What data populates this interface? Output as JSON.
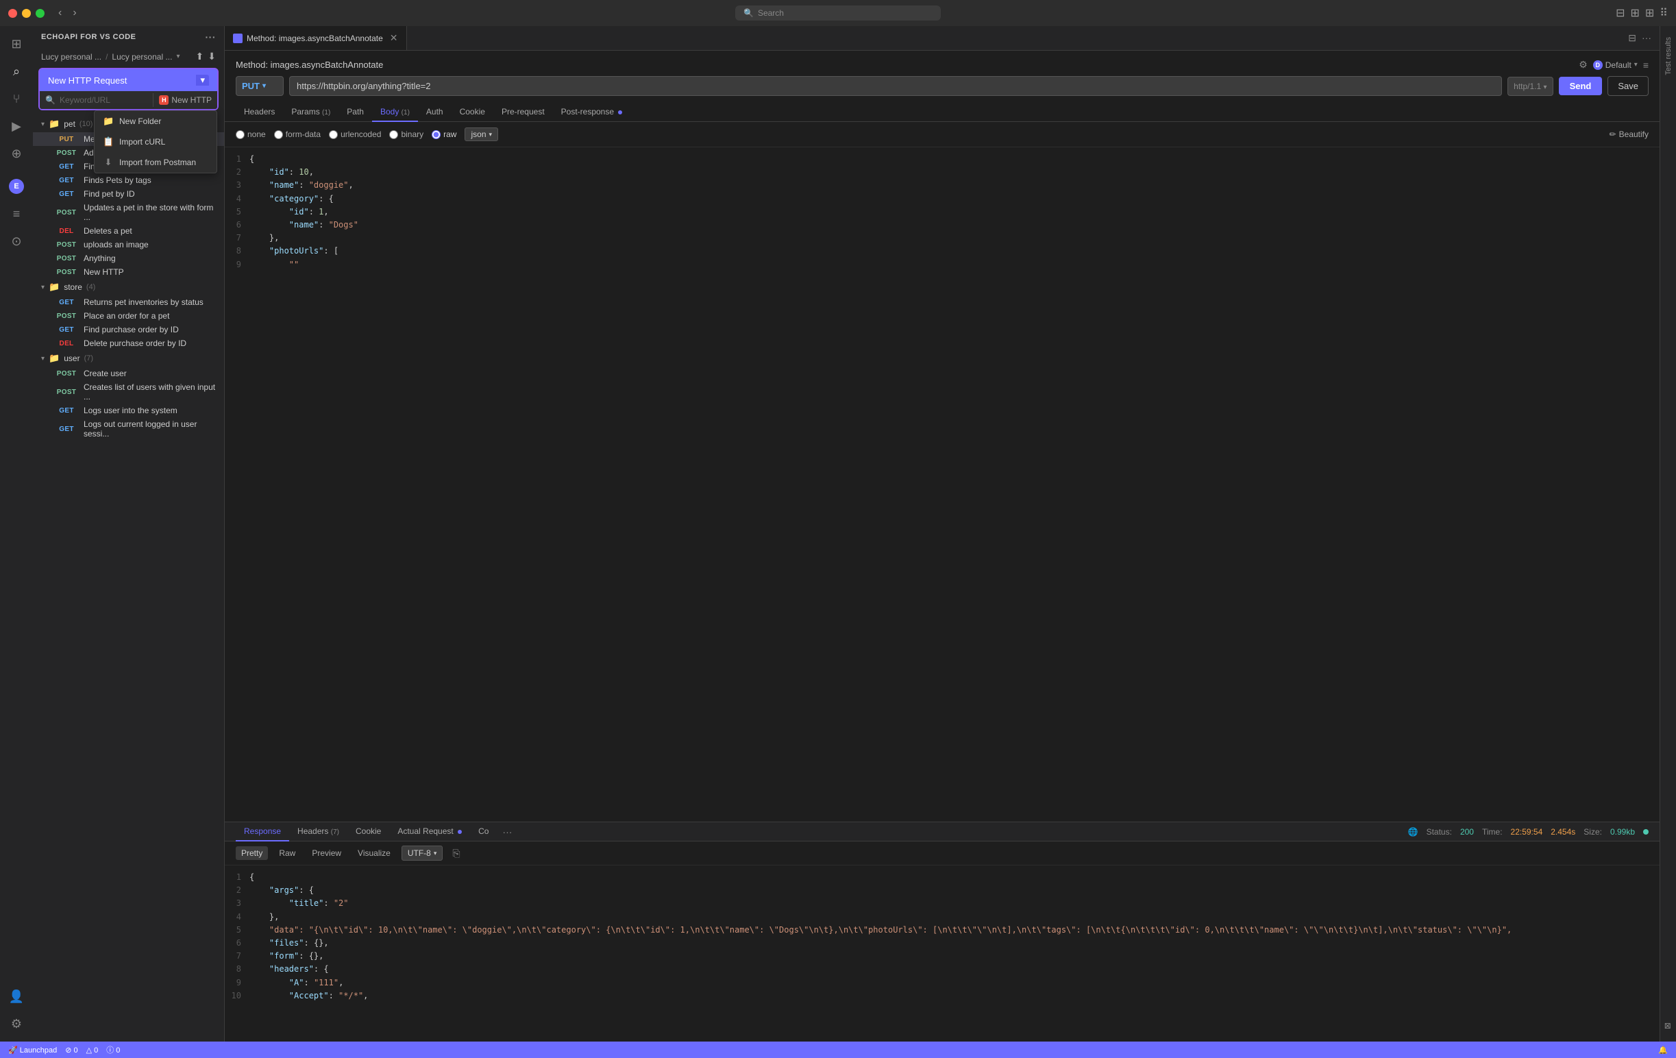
{
  "titlebar": {
    "search_placeholder": "Search"
  },
  "sidebar": {
    "title": "ECHOAPI FOR VS CODE",
    "workspace": "Lucy personal ...",
    "workspace_full": "Lucy personal ...",
    "new_request_label": "New HTTP Request",
    "search_placeholder": "Keyword/URL",
    "new_http_label": "New HTTP",
    "dropdown": {
      "items": [
        {
          "icon": "📁",
          "label": "New Folder"
        },
        {
          "icon": "📋",
          "label": "Import cURL"
        },
        {
          "icon": "⬇",
          "label": "Import from Postman"
        }
      ]
    },
    "groups": [
      {
        "name": "pet",
        "count": 10,
        "items": [
          {
            "method": "PUT",
            "label": "Method: images..."
          },
          {
            "method": "POST",
            "label": "Add a new pet t..."
          },
          {
            "method": "GET",
            "label": "Finds Pets by st..."
          },
          {
            "method": "GET",
            "label": "Finds Pets by tags"
          },
          {
            "method": "GET",
            "label": "Find pet by ID"
          },
          {
            "method": "POST",
            "label": "Updates a pet in the store with form ..."
          },
          {
            "method": "DEL",
            "label": "Deletes a pet"
          },
          {
            "method": "POST",
            "label": "uploads an image"
          },
          {
            "method": "POST",
            "label": "Anything"
          },
          {
            "method": "POST",
            "label": "New HTTP"
          }
        ]
      },
      {
        "name": "store",
        "count": 4,
        "items": [
          {
            "method": "GET",
            "label": "Returns pet inventories by status"
          },
          {
            "method": "POST",
            "label": "Place an order for a pet"
          },
          {
            "method": "GET",
            "label": "Find purchase order by ID"
          },
          {
            "method": "DEL",
            "label": "Delete purchase order by ID"
          }
        ]
      },
      {
        "name": "user",
        "count": 7,
        "items": [
          {
            "method": "POST",
            "label": "Create user"
          },
          {
            "method": "POST",
            "label": "Creates list of users with given input ..."
          },
          {
            "method": "GET",
            "label": "Logs user into the system"
          },
          {
            "method": "GET",
            "label": "Logs out current logged in user sessi..."
          }
        ]
      }
    ]
  },
  "main": {
    "tab_label": "Method: images.asyncBatchAnnotate",
    "request_title": "Method: images.asyncBatchAnnotate",
    "method": "PUT",
    "url": "https://httpbin.org/anything?title=2",
    "protocol": "http/1.1",
    "send_label": "Send",
    "save_label": "Save",
    "default_label": "Default",
    "tabs": {
      "headers": "Headers",
      "params": "Params",
      "params_count": "1",
      "path": "Path",
      "body": "Body",
      "body_count": "1",
      "auth": "Auth",
      "cookie": "Cookie",
      "pre_request": "Pre-request",
      "post_response": "Post-response"
    },
    "body_options": {
      "none": "none",
      "form_data": "form-data",
      "urlencoded": "urlencoded",
      "binary": "binary",
      "raw": "raw",
      "json": "json"
    },
    "beautify": "Beautify",
    "code_lines": [
      {
        "num": "1",
        "content": "{"
      },
      {
        "num": "2",
        "content": "    \"id\": 10,"
      },
      {
        "num": "3",
        "content": "    \"name\": \"doggie\","
      },
      {
        "num": "4",
        "content": "    \"category\": {"
      },
      {
        "num": "5",
        "content": "        \"id\": 1,"
      },
      {
        "num": "6",
        "content": "        \"name\": \"Dogs\""
      },
      {
        "num": "7",
        "content": "    },"
      },
      {
        "num": "8",
        "content": "    \"photoUrls\": ["
      },
      {
        "num": "9",
        "content": "        \"\""
      }
    ],
    "response": {
      "tabs": {
        "response": "Response",
        "headers": "Headers",
        "headers_count": "7",
        "cookie": "Cookie",
        "actual_request": "Actual Request",
        "co": "Co"
      },
      "status_label": "Status:",
      "status_code": "200",
      "time_label": "Time:",
      "time_value": "22:59:54",
      "duration": "2.454s",
      "size_label": "Size:",
      "size_value": "0.99kb",
      "format_options": [
        "Pretty",
        "Raw",
        "Preview",
        "Visualize"
      ],
      "encoding": "UTF-8",
      "code_lines": [
        {
          "num": "1",
          "content": "{"
        },
        {
          "num": "2",
          "content": "    \"args\": {"
        },
        {
          "num": "3",
          "content": "        \"title\": \"2\""
        },
        {
          "num": "4",
          "content": "    },"
        },
        {
          "num": "5",
          "content": "    \"data\": \"{\\n\\t\\\"id\\\": 10,\\n\\t\\\"name\\\": \\\"doggie\\\",\\n\\t\\\"category\\\": {\\n\\t\\t\\\"id\\\": 1,\\n\\t\\t\\\"name\\\": \\\"Dogs\\\"\\n\\t},\\n\\t\\\"photoUrls\\\": [\\n\\t\\t\\\"\\\"\\n\\t],\\n\\t\\\"tags\\\": [\\n\\t\\t{\\n\\t\\t\\t\\\"id\\\": 0,\\n\\t\\t\\t\\\"name\\\": \\\"\\\"\\n\\t\\t}\\n\\t],\\n\\t\\\"status\\\": \\\"\\\"\\n}\","
        },
        {
          "num": "6",
          "content": "    \"files\": {},"
        },
        {
          "num": "7",
          "content": "    \"form\": {},"
        },
        {
          "num": "8",
          "content": "    \"headers\": {"
        },
        {
          "num": "9",
          "content": "        \"A\": \"111\","
        },
        {
          "num": "10",
          "content": "        \"Accept\": \"*/*\","
        }
      ]
    }
  },
  "right_panel": {
    "label": "Test results"
  },
  "status_bar": {
    "launchpad": "🚀 Launchpad",
    "warnings": "⊘ 0",
    "errors": "△ 0",
    "info": "ⓘ 0",
    "bell_icon": "🔔"
  },
  "activity_icons": [
    {
      "name": "files-icon",
      "symbol": "⊞",
      "active": false
    },
    {
      "name": "search-icon",
      "symbol": "🔍",
      "active": true
    },
    {
      "name": "source-control-icon",
      "symbol": "⑂",
      "active": false
    },
    {
      "name": "run-icon",
      "symbol": "▶",
      "active": false
    },
    {
      "name": "extensions-icon",
      "symbol": "⊕",
      "active": false
    },
    {
      "name": "collections-icon",
      "symbol": "≡",
      "active": false
    },
    {
      "name": "history-icon",
      "symbol": "⊙",
      "active": false
    }
  ]
}
